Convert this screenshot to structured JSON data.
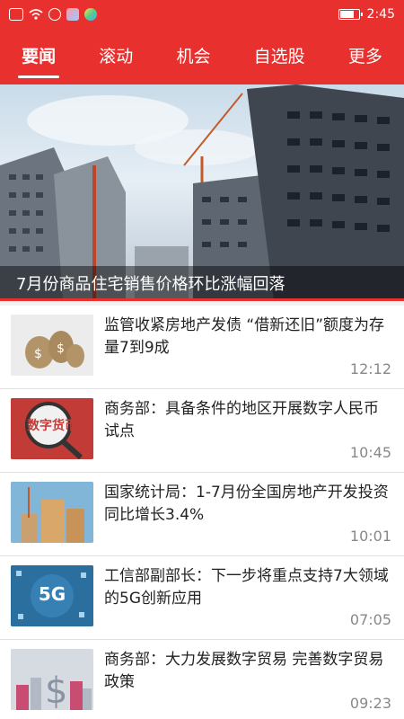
{
  "status_bar": {
    "time": "2:45",
    "battery_level": 0.8
  },
  "tabs": [
    {
      "label": "要闻",
      "active": true
    },
    {
      "label": "滚动",
      "active": false
    },
    {
      "label": "机会",
      "active": false
    },
    {
      "label": "自选股",
      "active": false
    },
    {
      "label": "更多",
      "active": false
    }
  ],
  "hero": {
    "caption": "7月份商品住宅销售价格环比涨幅回落"
  },
  "news": [
    {
      "title": "监管收紧房地产发债 “借新还旧”额度为存量7到9成",
      "time": "12:12",
      "thumb_icon": "money-bags-icon"
    },
    {
      "title": "商务部：具备条件的地区开展数字人民币试点",
      "time": "10:45",
      "thumb_icon": "digital-currency-icon",
      "thumb_text": "数字货币"
    },
    {
      "title": "国家统计局：1-7月份全国房地产开发投资同比增长3.4%",
      "time": "10:01",
      "thumb_icon": "buildings-icon"
    },
    {
      "title": "工信部副部长：下一步将重点支持7大领域的5G创新应用",
      "time": "07:05",
      "thumb_icon": "5g-network-icon",
      "thumb_text": "5G"
    },
    {
      "title": "商务部：大力发展数字贸易 完善数字贸易政策",
      "time": "09:23",
      "thumb_icon": "dollar-city-icon"
    }
  ]
}
